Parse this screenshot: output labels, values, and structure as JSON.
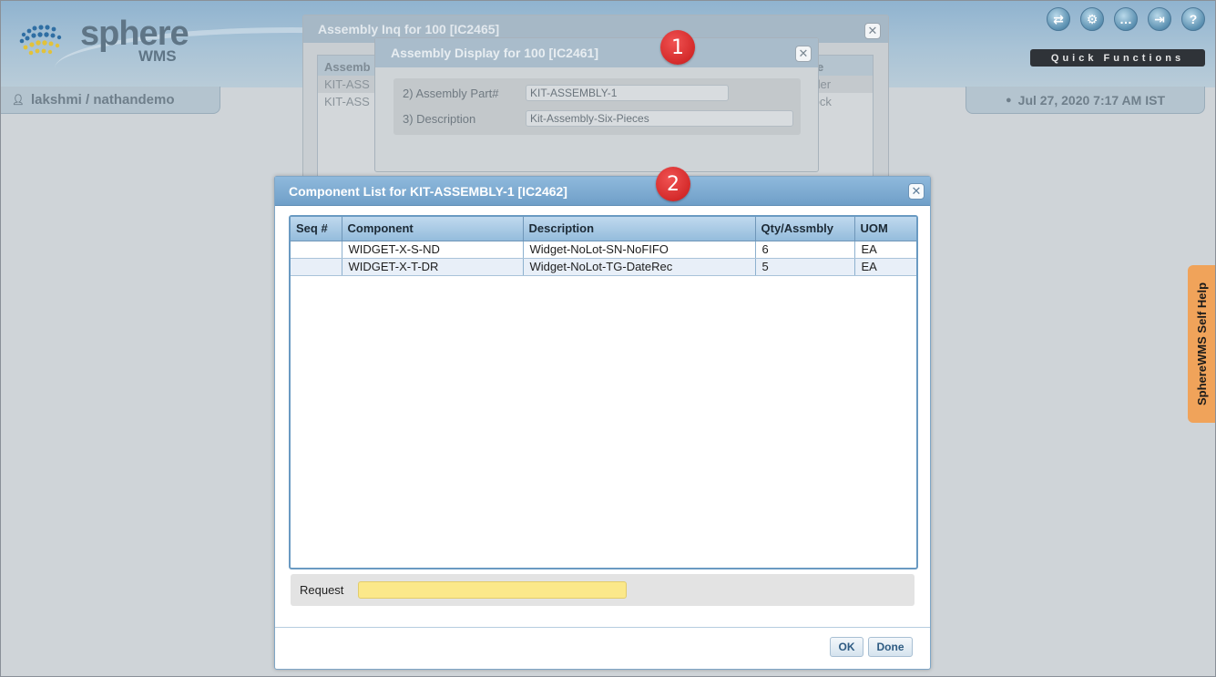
{
  "header": {
    "logo_main": "sphere",
    "logo_sub": "WMS",
    "icons": [
      "swap-icon",
      "gear-icon",
      "chat-icon",
      "logout-icon",
      "help-icon"
    ],
    "quick_functions": "Quick Functions",
    "user": "lakshmi / nathandemo",
    "datetime": "Jul 27, 2020 7:17 AM IST"
  },
  "self_help": "SphereWMS Self Help",
  "bg_dialog": {
    "title": "Assembly Inq for 100 [IC2465]",
    "header_left": "Assemb",
    "header_right": "e",
    "rows": [
      {
        "left": "KIT-ASS",
        "right": "rder"
      },
      {
        "left": "KIT-ASS",
        "right": "tock"
      }
    ]
  },
  "assembly_display": {
    "title": "Assembly Display for 100 [IC2461]",
    "part_label": "2) Assembly Part#",
    "part_value": "KIT-ASSEMBLY-1",
    "desc_label": "3) Description",
    "desc_value": "Kit-Assembly-Six-Pieces"
  },
  "badges": {
    "one": "1",
    "two": "2"
  },
  "component_list": {
    "title": "Component List for KIT-ASSEMBLY-1 [IC2462]",
    "columns": [
      "Seq #",
      "Component",
      "Description",
      "Qty/Assmbly",
      "UOM"
    ],
    "rows": [
      {
        "seq": "",
        "component": "WIDGET-X-S-ND",
        "description": "Widget-NoLot-SN-NoFIFO",
        "qty": "6",
        "uom": "EA"
      },
      {
        "seq": "",
        "component": "WIDGET-X-T-DR",
        "description": "Widget-NoLot-TG-DateRec",
        "qty": "5",
        "uom": "EA"
      }
    ],
    "request_label": "Request",
    "request_value": "",
    "ok_label": "OK",
    "done_label": "Done"
  },
  "colors": {
    "title_bar": "#7faad1",
    "request_field": "#fbe88a",
    "badge": "#d42a2a",
    "self_help_tab": "#f0a35a"
  }
}
